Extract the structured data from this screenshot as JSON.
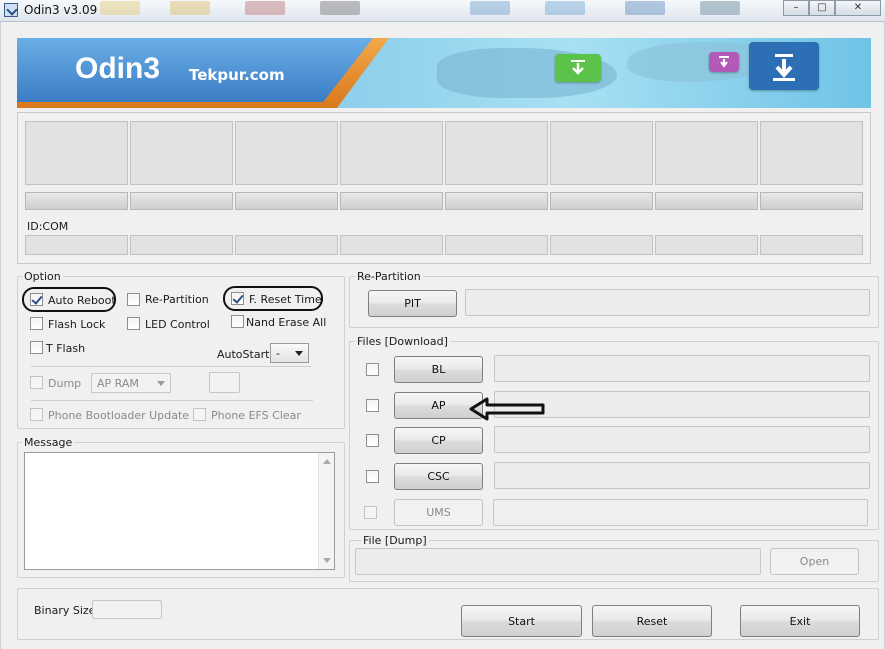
{
  "window": {
    "title": "Odin3 v3.09"
  },
  "banner": {
    "brand": "Odin3",
    "site": "Tekpur.com"
  },
  "slots": {
    "id_com_label": "ID:COM"
  },
  "option": {
    "title": "Option",
    "auto_reboot": {
      "label": "Auto Reboot",
      "checked": true
    },
    "re_partition": {
      "label": "Re-Partition",
      "checked": false
    },
    "f_reset_time": {
      "label": "F. Reset Time",
      "checked": true
    },
    "flash_lock": {
      "label": "Flash Lock",
      "checked": false
    },
    "led_control": {
      "label": "LED Control",
      "checked": false
    },
    "nand_erase_all": {
      "label": "Nand Erase All",
      "checked": false
    },
    "t_flash": {
      "label": "T Flash",
      "checked": false
    },
    "autostart_label": "AutoStart",
    "autostart_value": "-",
    "dump": {
      "label": "Dump",
      "checked": false
    },
    "dump_select": "AP RAM",
    "phone_bootloader_update": {
      "label": "Phone Bootloader Update",
      "checked": false
    },
    "phone_efs_clear": {
      "label": "Phone EFS Clear",
      "checked": false
    }
  },
  "message": {
    "title": "Message"
  },
  "repartition": {
    "title": "Re-Partition",
    "pit_button": "PIT"
  },
  "files": {
    "title": "Files [Download]",
    "rows": [
      {
        "button": "BL",
        "checked": false
      },
      {
        "button": "AP",
        "checked": false
      },
      {
        "button": "CP",
        "checked": false
      },
      {
        "button": "CSC",
        "checked": false
      },
      {
        "button": "UMS",
        "checked": false
      }
    ]
  },
  "dump": {
    "title": "File [Dump]",
    "open_button": "Open"
  },
  "binary_size": {
    "label": "Binary Size"
  },
  "actions": {
    "start": "Start",
    "reset": "Reset",
    "exit": "Exit"
  },
  "annotation_colors": {
    "outline": "#111111"
  }
}
